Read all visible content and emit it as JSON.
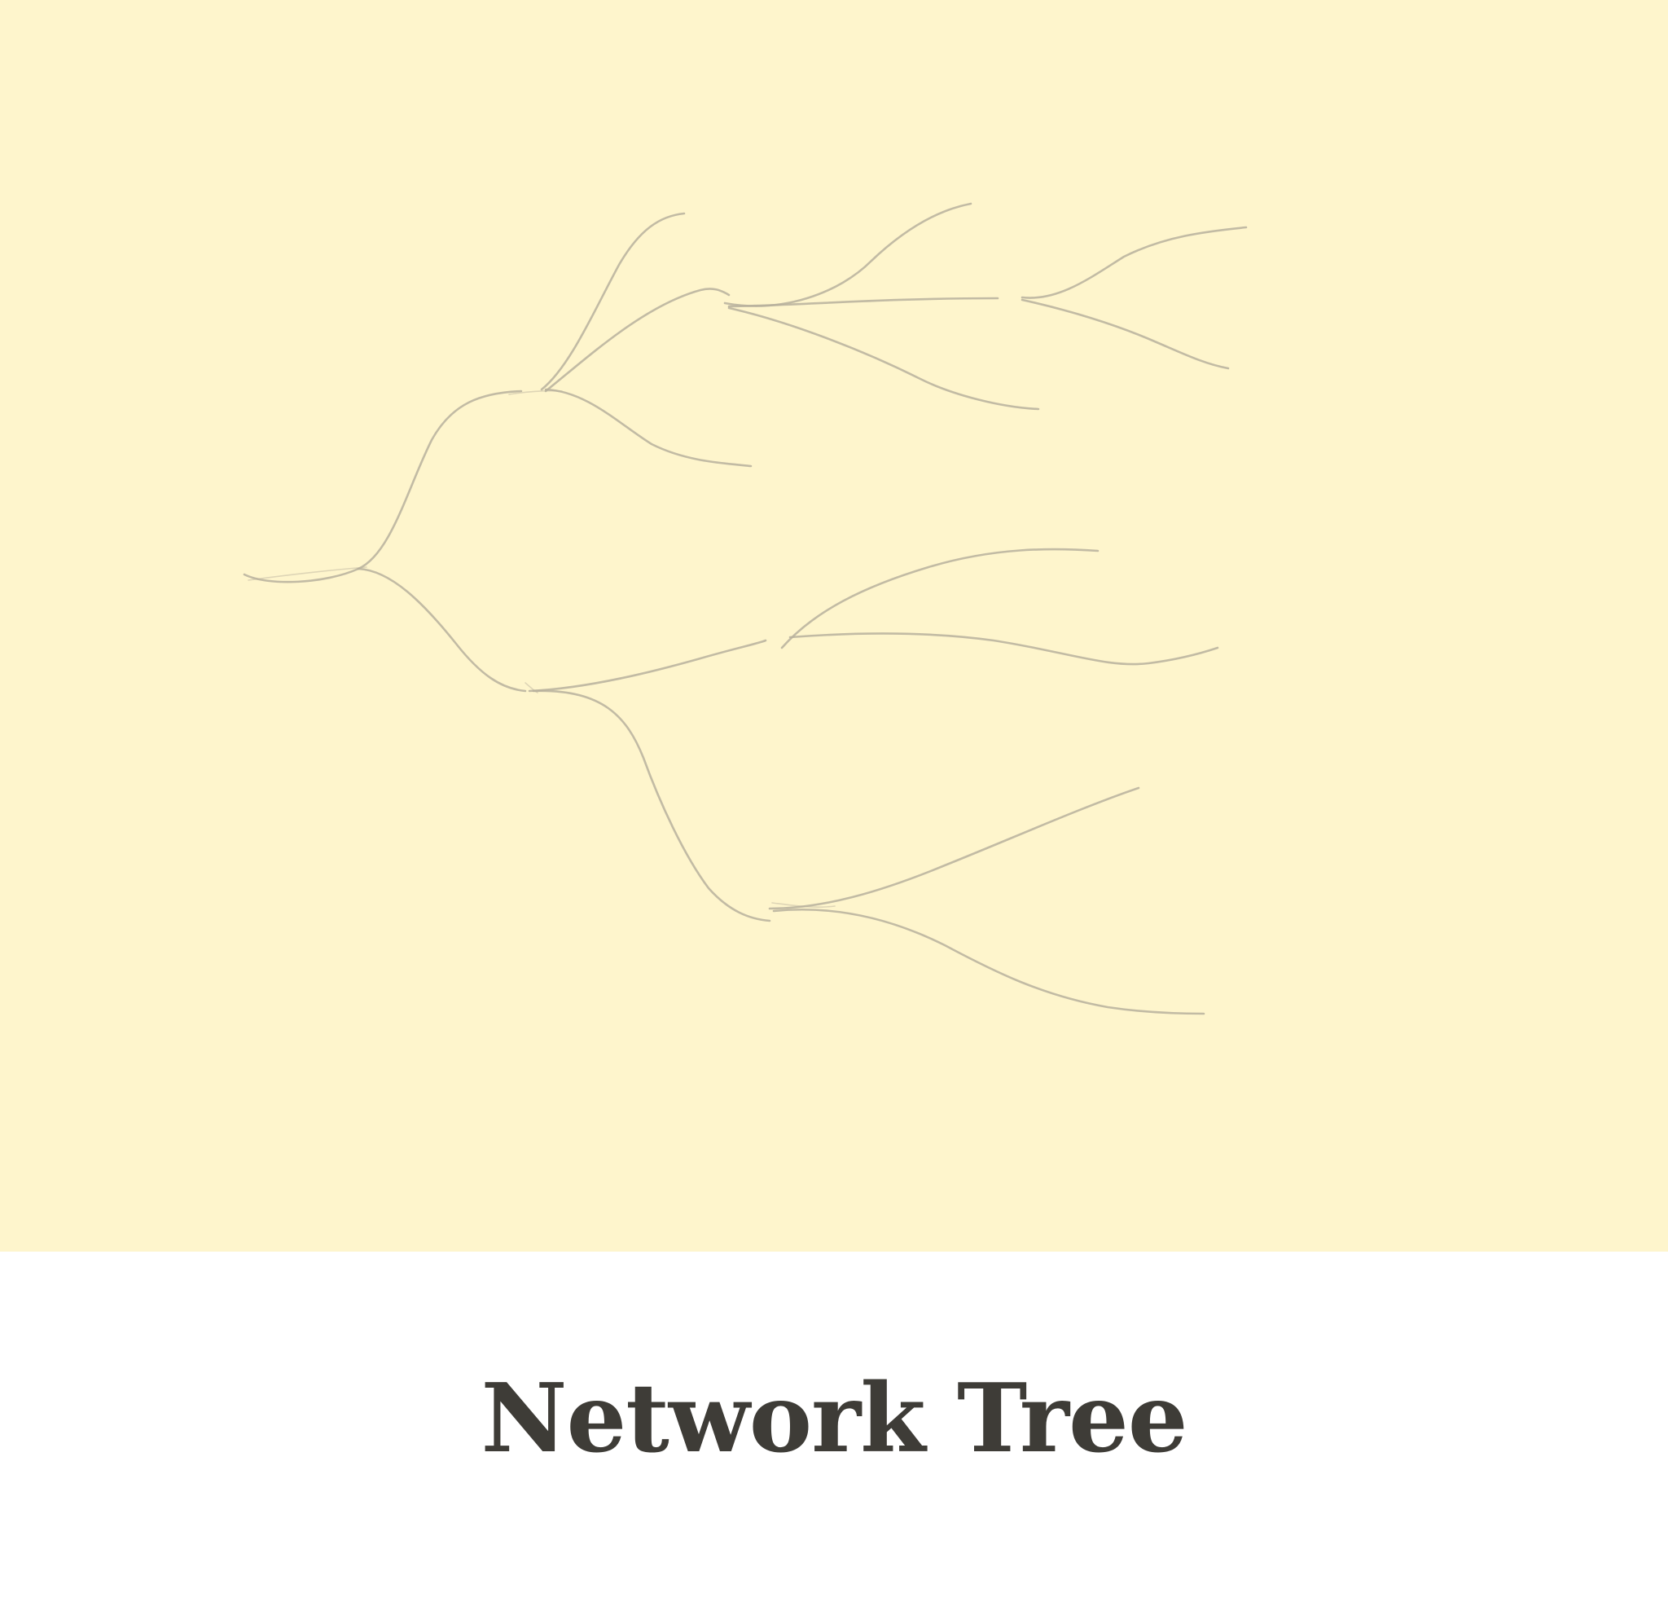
{
  "card": {
    "title": "Network Tree",
    "background_color": "#fef5cc",
    "line_color": "#b7b09c",
    "title_color": "#3e3c37",
    "style": "pencil-sketch"
  }
}
